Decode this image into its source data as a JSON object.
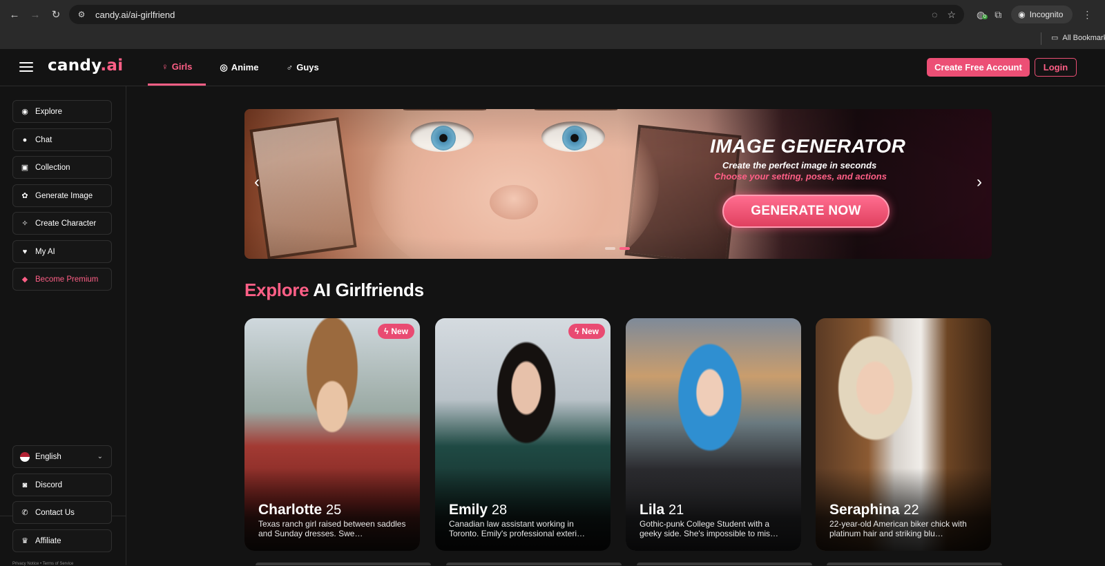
{
  "browser": {
    "url": "candy.ai/ai-girlfriend",
    "incognito_label": "Incognito",
    "bookmarks_label": "All Bookmarks",
    "extension_badge": "0"
  },
  "header": {
    "logo_main": "candy",
    "logo_ai": ".ai",
    "tabs": [
      {
        "label": "Girls",
        "icon": "female-icon"
      },
      {
        "label": "Anime",
        "icon": "anime-icon"
      },
      {
        "label": "Guys",
        "icon": "male-icon"
      }
    ],
    "create_account_label": "Create Free Account",
    "login_label": "Login"
  },
  "sidebar": {
    "items": [
      {
        "label": "Explore",
        "icon": "compass-icon"
      },
      {
        "label": "Chat",
        "icon": "chat-icon"
      },
      {
        "label": "Collection",
        "icon": "collection-icon"
      },
      {
        "label": "Generate Image",
        "icon": "image-gen-icon"
      },
      {
        "label": "Create Character",
        "icon": "wand-icon"
      },
      {
        "label": "My AI",
        "icon": "heart-hands-icon"
      },
      {
        "label": "Become Premium",
        "icon": "diamond-icon"
      }
    ],
    "footer_items": [
      {
        "label": "English",
        "icon": "us-flag-icon"
      },
      {
        "label": "Discord",
        "icon": "discord-icon"
      },
      {
        "label": "Contact Us",
        "icon": "contact-icon"
      },
      {
        "label": "Affiliate",
        "icon": "trophy-icon"
      }
    ],
    "legal": "Privacy Notice  •  Terms of Service"
  },
  "banner": {
    "title": "IMAGE GENERATOR",
    "subtitle": "Create the perfect image in seconds",
    "subtitle_accent": "Choose your setting, poses, and actions",
    "cta_label": "GENERATE NOW",
    "slide_count": 2,
    "active_slide": 2
  },
  "explore": {
    "heading_accent": "Explore",
    "heading_rest": " AI Girlfriends"
  },
  "cards": [
    {
      "name": "Charlotte",
      "age": "25",
      "badge": "New",
      "desc": "Texas ranch girl raised between saddles and Sunday dresses. Swe…"
    },
    {
      "name": "Emily",
      "age": "28",
      "badge": "New",
      "desc": "Canadian law assistant working in Toronto. Emily's professional exteri…"
    },
    {
      "name": "Lila",
      "age": "21",
      "badge": "",
      "desc": "Gothic-punk College Student with a geeky side. She's impossible to mis…"
    },
    {
      "name": "Seraphina",
      "age": "22",
      "badge": "",
      "desc": "22-year-old American biker chick with platinum hair and striking blu…"
    }
  ],
  "colors": {
    "accent": "#ff5f86",
    "button": "#ec4f75",
    "background": "#131313"
  }
}
